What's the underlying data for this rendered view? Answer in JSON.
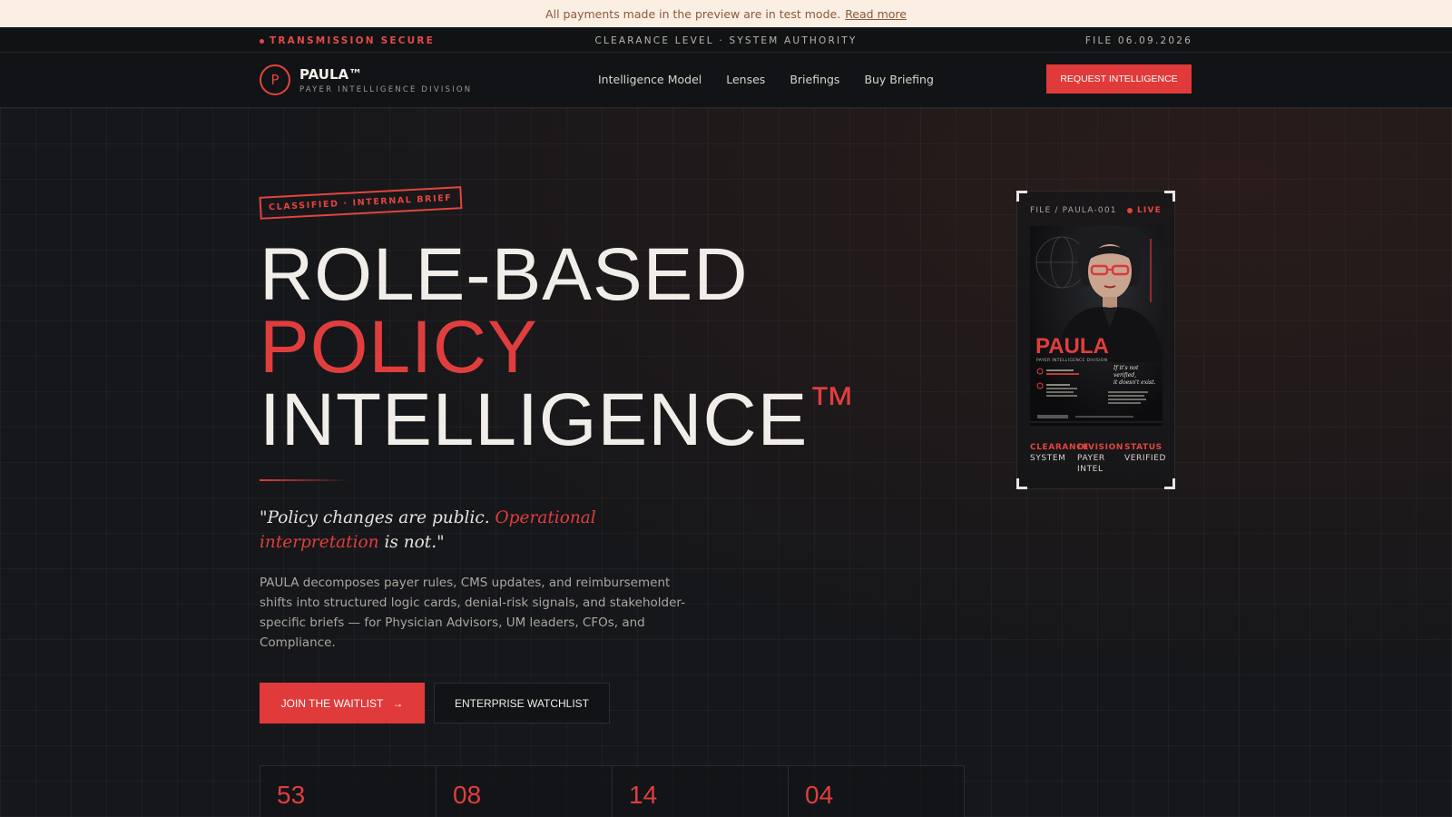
{
  "banner": {
    "text": "All payments made in the preview are in test mode.",
    "link": "Read more"
  },
  "sysbar": {
    "left": "TRANSMISSION SECURE",
    "center": "CLEARANCE LEVEL · SYSTEM AUTHORITY",
    "right": "FILE 06.09.2026"
  },
  "brand": {
    "mark": "P",
    "name": "PAULA™",
    "subtitle": "PAYER INTELLIGENCE DIVISION"
  },
  "nav": {
    "links": [
      "Intelligence Model",
      "Lenses",
      "Briefings",
      "Buy Briefing"
    ],
    "cta": "REQUEST INTELLIGENCE"
  },
  "hero": {
    "stamp": "CLASSIFIED · INTERNAL BRIEF",
    "headline": {
      "line1": "ROLE-BASED",
      "line2": "POLICY",
      "line3": "INTELLIGENCE",
      "tm": "™"
    },
    "quote": {
      "before": "\"Policy changes are public. ",
      "highlight": "Operational interpretation",
      "after": " is not.\""
    },
    "description": "PAULA decomposes payer rules, CMS updates, and reimbursement shifts into structured logic cards, denial-risk signals, and stakeholder-specific briefs — for Physician Advisors, UM leaders, CFOs, and Compliance.",
    "primary_button": "JOIN THE WAITLIST",
    "primary_arrow": "→",
    "secondary_button": "ENTERPRISE WATCHLIST"
  },
  "stats": [
    "53",
    "08",
    "14",
    "04"
  ],
  "card": {
    "file": "FILE / PAULA-001",
    "live": "LIVE",
    "poster": {
      "name": "PAULA",
      "subtitle": "PAYER INTELLIGENCE DIVISION",
      "tagline": [
        "If it's not",
        "verified,",
        "it doesn't exist."
      ]
    },
    "meta": [
      {
        "key": "CLEARANCE",
        "value": "SYSTEM"
      },
      {
        "key": "DIVISION",
        "value": "PAYER INTEL"
      },
      {
        "key": "STATUS",
        "value": "VERIFIED"
      }
    ]
  },
  "colors": {
    "accent": "#e03e3e",
    "background": "#151619",
    "banner_bg": "#fbeee2"
  }
}
